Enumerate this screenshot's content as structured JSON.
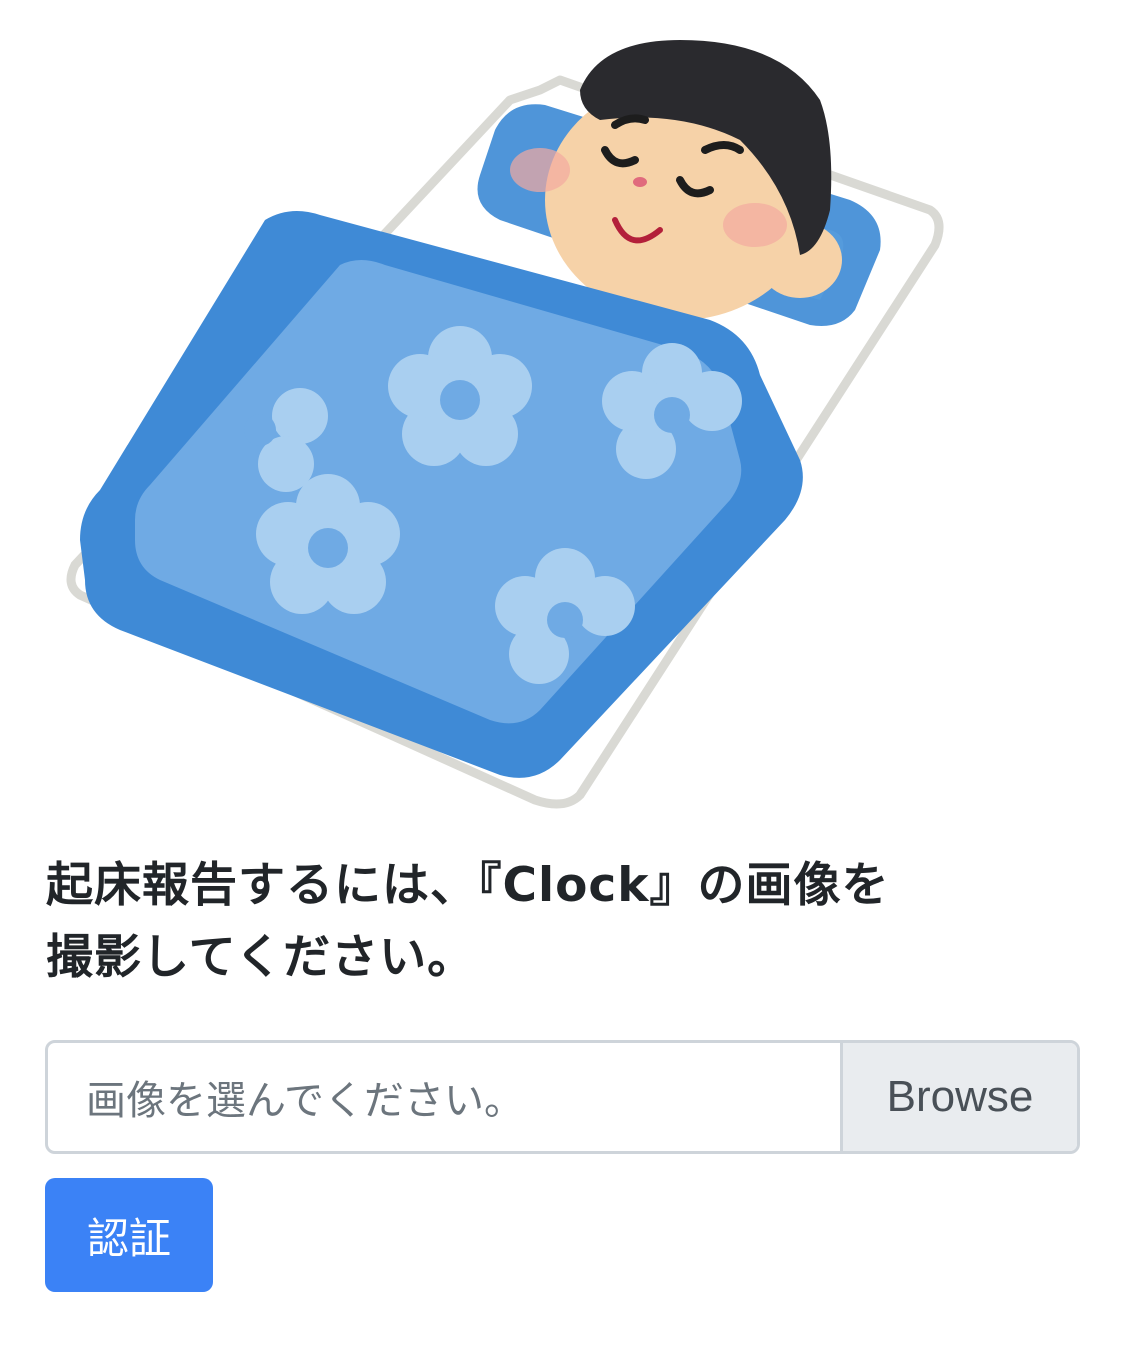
{
  "instruction": {
    "line1": "起床報告するには、『Clock』の画像を",
    "line2": "撮影してください。"
  },
  "file_input": {
    "placeholder": "画像を選んでください。",
    "browse_label": "Browse"
  },
  "submit_label": "認証",
  "colors": {
    "primary": "#3b82f6",
    "input_border": "#ced4da",
    "browse_bg": "#e9ecef",
    "futon_dark": "#3f8ad6",
    "futon_light": "#6faae4",
    "flower": "#a9cff0",
    "skin": "#f6d2a8",
    "hair": "#2a2a2e"
  },
  "illustration": {
    "icon": "sleeping-boy-illustration"
  }
}
